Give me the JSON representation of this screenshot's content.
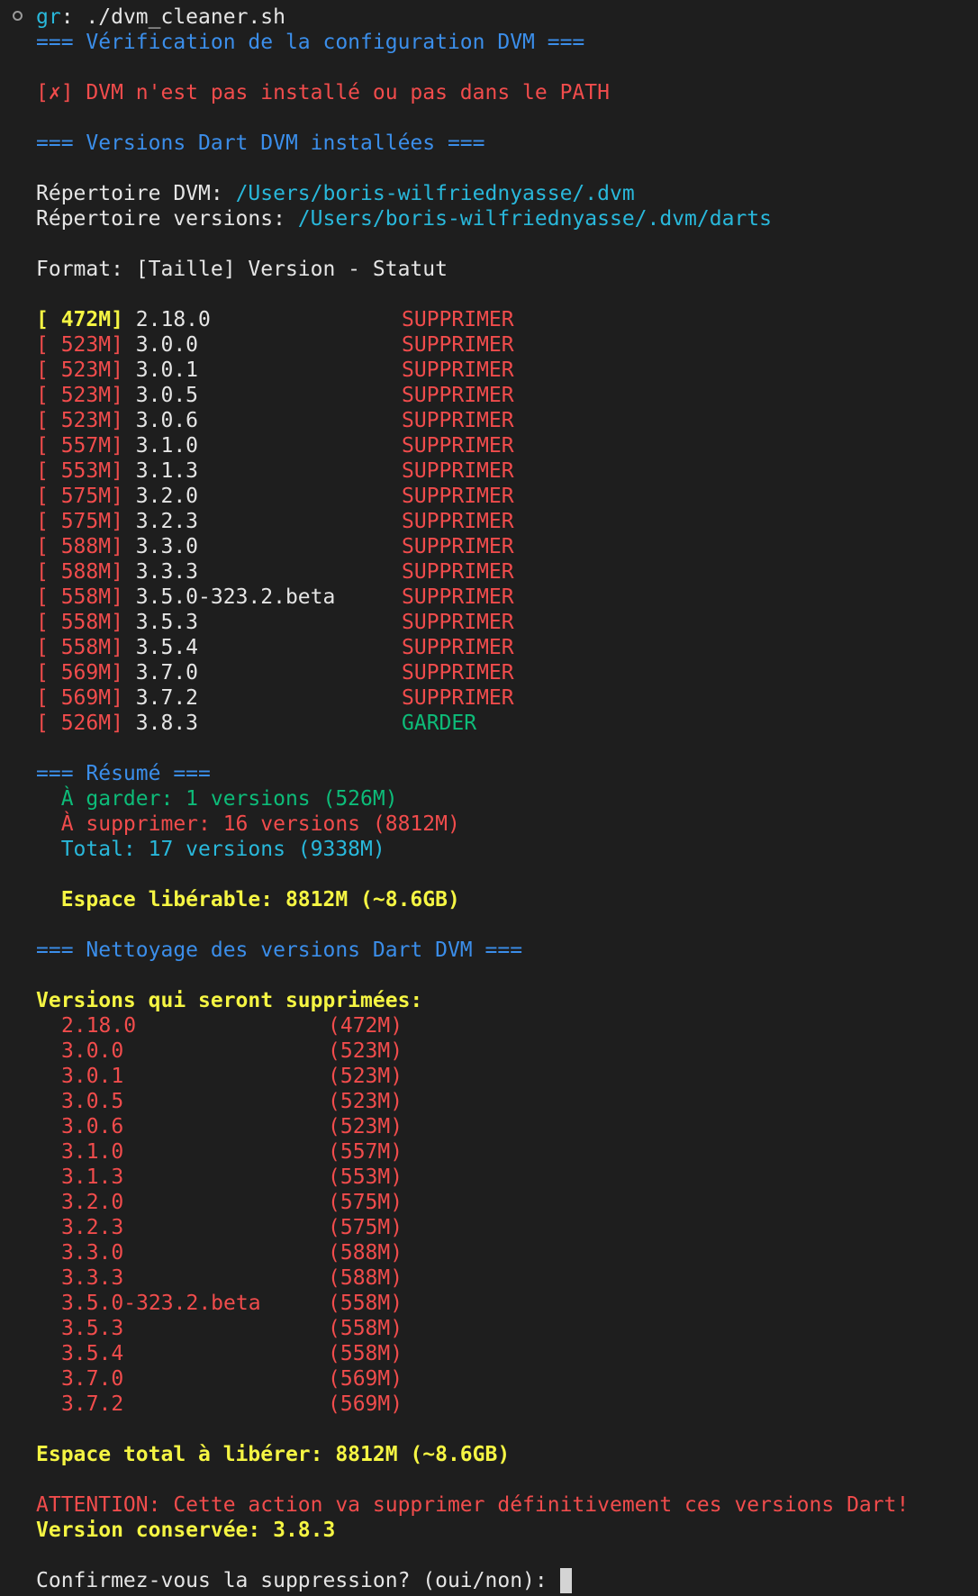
{
  "prompt": {
    "label": "gr",
    "separator": ": ",
    "command": "./dvm_cleaner.sh"
  },
  "config_check": {
    "header": "=== Vérification de la configuration DVM ===",
    "error": "[✗] DVM n'est pas installé ou pas dans le PATH"
  },
  "installed": {
    "header": "=== Versions Dart DVM installées ===",
    "dvm_dir_label": "Répertoire DVM: ",
    "dvm_dir_value": "/Users/boris-wilfriednyasse/.dvm",
    "versions_dir_label": "Répertoire versions: ",
    "versions_dir_value": "/Users/boris-wilfriednyasse/.dvm/darts",
    "format_line": "Format: [Taille] Version - Statut",
    "versions": [
      {
        "size": "[ 472M]",
        "version": "2.18.0",
        "status": "SUPPRIMER"
      },
      {
        "size": "[ 523M]",
        "version": "3.0.0",
        "status": "SUPPRIMER"
      },
      {
        "size": "[ 523M]",
        "version": "3.0.1",
        "status": "SUPPRIMER"
      },
      {
        "size": "[ 523M]",
        "version": "3.0.5",
        "status": "SUPPRIMER"
      },
      {
        "size": "[ 523M]",
        "version": "3.0.6",
        "status": "SUPPRIMER"
      },
      {
        "size": "[ 557M]",
        "version": "3.1.0",
        "status": "SUPPRIMER"
      },
      {
        "size": "[ 553M]",
        "version": "3.1.3",
        "status": "SUPPRIMER"
      },
      {
        "size": "[ 575M]",
        "version": "3.2.0",
        "status": "SUPPRIMER"
      },
      {
        "size": "[ 575M]",
        "version": "3.2.3",
        "status": "SUPPRIMER"
      },
      {
        "size": "[ 588M]",
        "version": "3.3.0",
        "status": "SUPPRIMER"
      },
      {
        "size": "[ 588M]",
        "version": "3.3.3",
        "status": "SUPPRIMER"
      },
      {
        "size": "[ 558M]",
        "version": "3.5.0-323.2.beta",
        "status": "SUPPRIMER"
      },
      {
        "size": "[ 558M]",
        "version": "3.5.3",
        "status": "SUPPRIMER"
      },
      {
        "size": "[ 558M]",
        "version": "3.5.4",
        "status": "SUPPRIMER"
      },
      {
        "size": "[ 569M]",
        "version": "3.7.0",
        "status": "SUPPRIMER"
      },
      {
        "size": "[ 569M]",
        "version": "3.7.2",
        "status": "SUPPRIMER"
      },
      {
        "size": "[ 526M]",
        "version": "3.8.3",
        "status": "GARDER"
      }
    ]
  },
  "summary": {
    "header": "=== Résumé ===",
    "keep": "  À garder: 1 versions (526M)",
    "delete": "  À supprimer: 16 versions (8812M)",
    "total": "  Total: 17 versions (9338M)",
    "freeable": "  Espace libérable: 8812M (~8.6GB)"
  },
  "cleanup": {
    "header": "=== Nettoyage des versions Dart DVM ===",
    "list_title": "Versions qui seront supprimées:",
    "items": [
      {
        "version": "2.18.0",
        "size": "(472M)"
      },
      {
        "version": "3.0.0",
        "size": "(523M)"
      },
      {
        "version": "3.0.1",
        "size": "(523M)"
      },
      {
        "version": "3.0.5",
        "size": "(523M)"
      },
      {
        "version": "3.0.6",
        "size": "(523M)"
      },
      {
        "version": "3.1.0",
        "size": "(557M)"
      },
      {
        "version": "3.1.3",
        "size": "(553M)"
      },
      {
        "version": "3.2.0",
        "size": "(575M)"
      },
      {
        "version": "3.2.3",
        "size": "(575M)"
      },
      {
        "version": "3.3.0",
        "size": "(588M)"
      },
      {
        "version": "3.3.3",
        "size": "(588M)"
      },
      {
        "version": "3.5.0-323.2.beta",
        "size": "(558M)"
      },
      {
        "version": "3.5.3",
        "size": "(558M)"
      },
      {
        "version": "3.5.4",
        "size": "(558M)"
      },
      {
        "version": "3.7.0",
        "size": "(569M)"
      },
      {
        "version": "3.7.2",
        "size": "(569M)"
      }
    ],
    "total_space": "Espace total à libérer: 8812M (~8.6GB)",
    "warning": "ATTENTION: Cette action va supprimer définitivement ces versions Dart!",
    "kept_version": "Version conservée: 3.8.3",
    "confirm_prompt": "Confirmez-vous la suppression? (oui/non): "
  }
}
